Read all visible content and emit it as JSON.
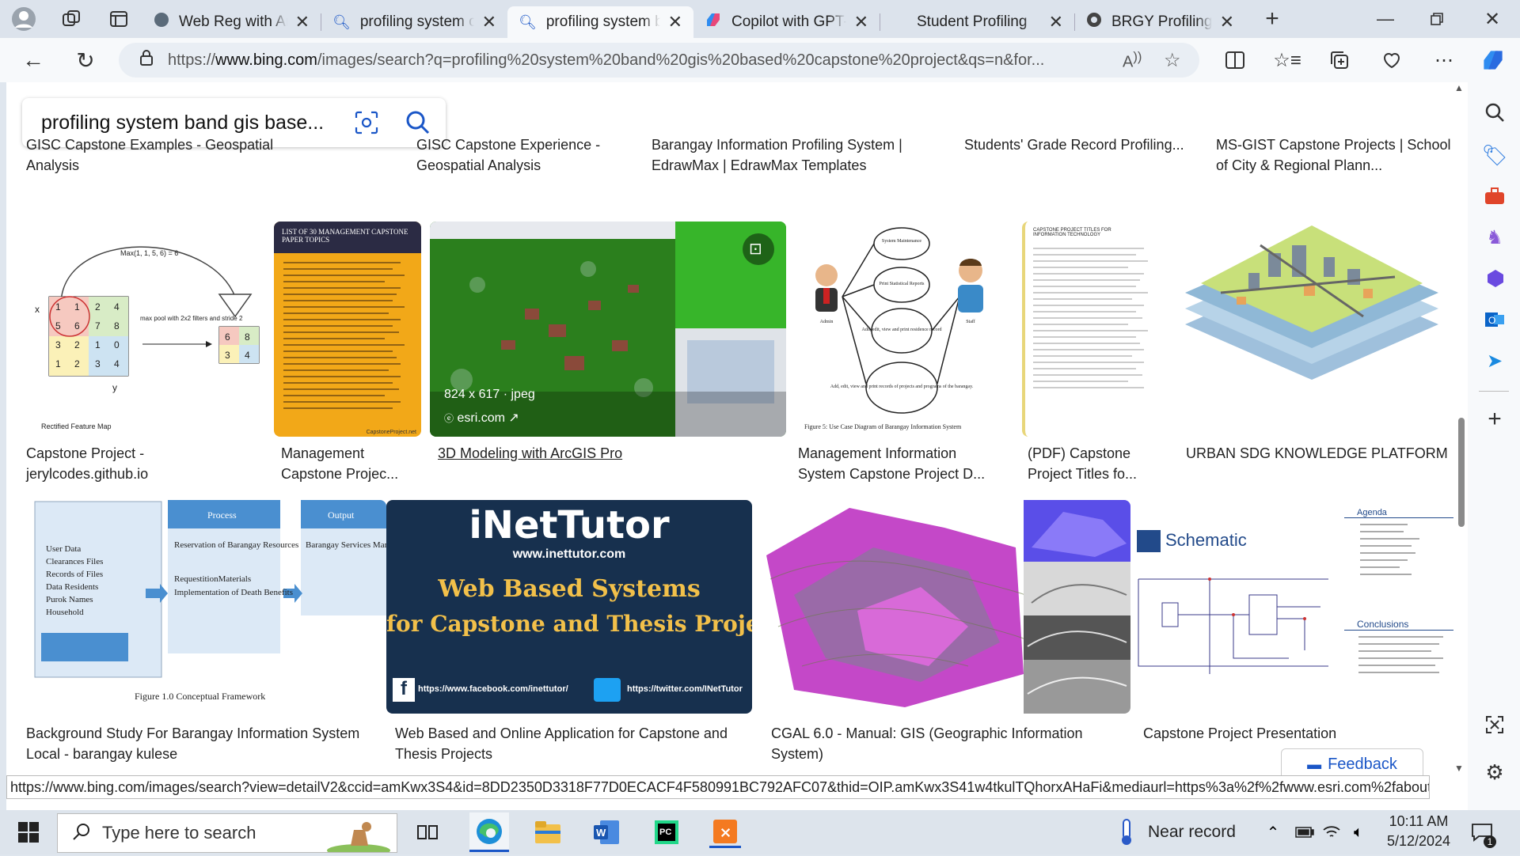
{
  "tabs": [
    {
      "title": "Web Reg with An",
      "icon": "web-reg-favicon"
    },
    {
      "title": "profiling system c",
      "icon": "bing-search-favicon"
    },
    {
      "title": "profiling system b",
      "icon": "bing-search-favicon"
    },
    {
      "title": "Copilot with GPT-",
      "icon": "copilot-favicon"
    },
    {
      "title": "Student Profiling",
      "icon": "blank-favicon"
    },
    {
      "title": "BRGY Profiling Sy",
      "icon": "github-favicon"
    }
  ],
  "address": {
    "prefix": "https://",
    "domain": "www.bing.com",
    "rest": "/images/search?q=profiling%20system%20band%20gis%20based%20capstone%20project&qs=n&for..."
  },
  "search": {
    "query": "profiling system band gis base..."
  },
  "top_captions": [
    "GISC Capstone Examples - Geospatial Analysis",
    "GISC Capstone Experience - Geospatial Analysis",
    "Barangay Information Profiling System | EdrawMax | EdrawMax Templates",
    "Students' Grade Record Profiling...",
    "MS-GIST Capstone Projects | School of City & Regional Plann..."
  ],
  "row1": [
    {
      "caption": "Capstone Project - jerylcodes.github.io",
      "thumb_title": "Max(1, 1, 5, 6) = 6",
      "thumb_note": "max pool with 2x2 filters and stride 2",
      "thumb_footer": "Rectified Feature Map",
      "axis_x": "x",
      "axis_y": "y"
    },
    {
      "caption": "Management Capstone Projec...",
      "thumb_title": "LIST OF 30 MANAGEMENT CAPSTONE PAPER TOPICS",
      "thumb_footer": "CapstoneProject.net"
    },
    {
      "caption": "3D Modeling with ArcGIS Pro",
      "overlay_size": "824 x 617 · jpeg",
      "overlay_source": "esri.com"
    },
    {
      "caption": "Management Information System Capstone Project D...",
      "thumb_footer": "Figure 5: Use Case Diagram of Barangay Information System",
      "bubbles": [
        "System Maintenance",
        "Print Statistical Reports",
        "Add, edit, view and print residence record",
        "Add, edit, view and print records of projects and programs of the barangay."
      ],
      "actor_left": "Admin",
      "actor_right": "Staff"
    },
    {
      "caption": "(PDF) Capstone Project Titles fo...",
      "thumb_title": "CAPSTONE PROJECT TITLES FOR INFORMATION TECHNOLOGY"
    },
    {
      "caption": "URBAN SDG KNOWLEDGE PLATFORM"
    }
  ],
  "row2": [
    {
      "caption": "Background Study For Barangay Information System Local - barangay kulese",
      "process": "Process",
      "output": "Output",
      "inputs": [
        "User Data",
        "Clearances Files",
        "Records of Files",
        "Data Residents",
        "Purok Names",
        "Household"
      ],
      "process_items": [
        "Reservation of Barangay Resources",
        "RequestitionMaterials",
        "Implementation of Death Benefits"
      ],
      "output_items": [
        "Barangay Services Management System"
      ],
      "figure": "Figure 1.0 Conceptual Framework"
    },
    {
      "caption": "Web Based and Online Application for Capstone and Thesis Projects",
      "brand": "iNetTutor",
      "site": "www.inettutor.com",
      "headline1": "Web Based Systems",
      "headline2": "for Capstone and Thesis Projects",
      "fb": "https://www.facebook.com/inettutor/",
      "tw": "https://twitter.com/INetTutor"
    },
    {
      "caption": "CGAL 6.0 - Manual: GIS (Geographic Information System)"
    },
    {
      "caption": "Capstone Project Presentation",
      "schematic": "Schematic",
      "agenda": "Agenda",
      "conclusions": "Conclusions"
    }
  ],
  "feedback": "Feedback",
  "status_url": "https://www.bing.com/images/search?view=detailV2&ccid=amKwx3S4&id=8DD2350D3318F77D0ECACF4F580991BC792AFC07&thid=OIP.amKwx3S41w4tkulTQhorxAHaFi&mediaurl=https%3a%2f%2fwww.esri.com%2fabout...",
  "taskbar": {
    "search_placeholder": "Type here to search",
    "weather": "Near record",
    "time": "10:11 AM",
    "date": "5/12/2024",
    "notif_count": "1"
  },
  "colors": {
    "accent": "#1a56c7",
    "link": "#1a0dab"
  }
}
